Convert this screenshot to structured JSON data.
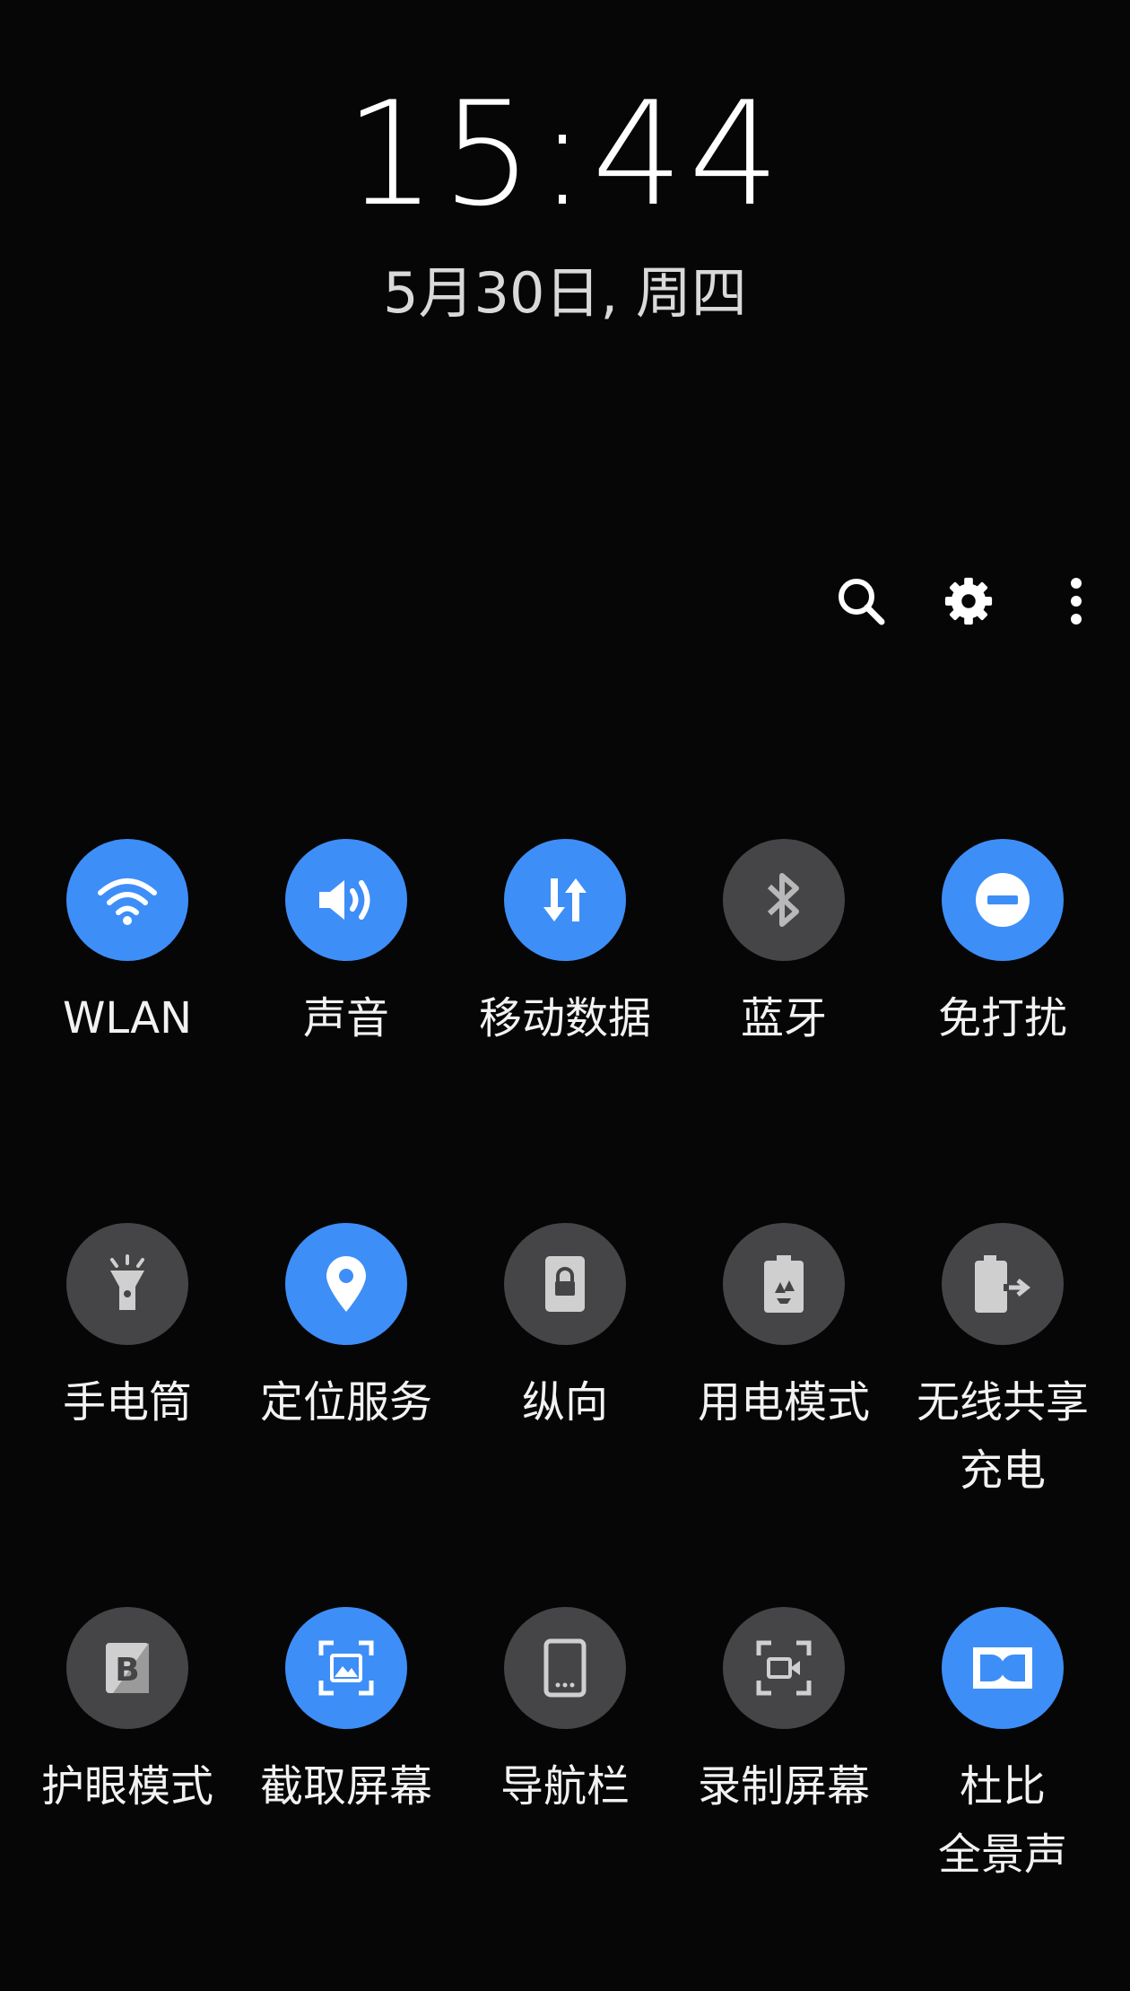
{
  "lockscreen": {
    "time": "15:44",
    "date": "5月30日, 周四"
  },
  "toolbar": {
    "icons": [
      "search-icon",
      "gear-icon",
      "more-vertical-icon"
    ]
  },
  "tiles": [
    {
      "label": "WLAN",
      "icon": "wifi-icon",
      "active": true
    },
    {
      "label": "声音",
      "icon": "volume-icon",
      "active": true
    },
    {
      "label": "移动数据",
      "icon": "data-arrows-icon",
      "active": true
    },
    {
      "label": "蓝牙",
      "icon": "bluetooth-icon",
      "active": false
    },
    {
      "label": "免打扰",
      "icon": "do-not-disturb-icon",
      "active": true
    },
    {
      "label": "手电筒",
      "icon": "flashlight-icon",
      "active": false
    },
    {
      "label": "定位服务",
      "icon": "location-pin-icon",
      "active": true
    },
    {
      "label": "纵向",
      "icon": "portrait-lock-icon",
      "active": false
    },
    {
      "label": "用电模式",
      "icon": "battery-recycle-icon",
      "active": false
    },
    {
      "label": "无线共享\n充电",
      "icon": "wireless-share-icon",
      "active": false
    },
    {
      "label": "护眼模式",
      "icon": "blue-light-filter-icon",
      "active": false
    },
    {
      "label": "截取屏幕",
      "icon": "screenshot-icon",
      "active": true
    },
    {
      "label": "导航栏",
      "icon": "navigation-bar-icon",
      "active": false
    },
    {
      "label": "录制屏幕",
      "icon": "screen-record-icon",
      "active": false
    },
    {
      "label": "杜比\n全景声",
      "icon": "dolby-atmos-icon",
      "active": true
    }
  ],
  "colors": {
    "active": "#3e8ef7",
    "inactive": "#454548",
    "background": "#060607"
  }
}
